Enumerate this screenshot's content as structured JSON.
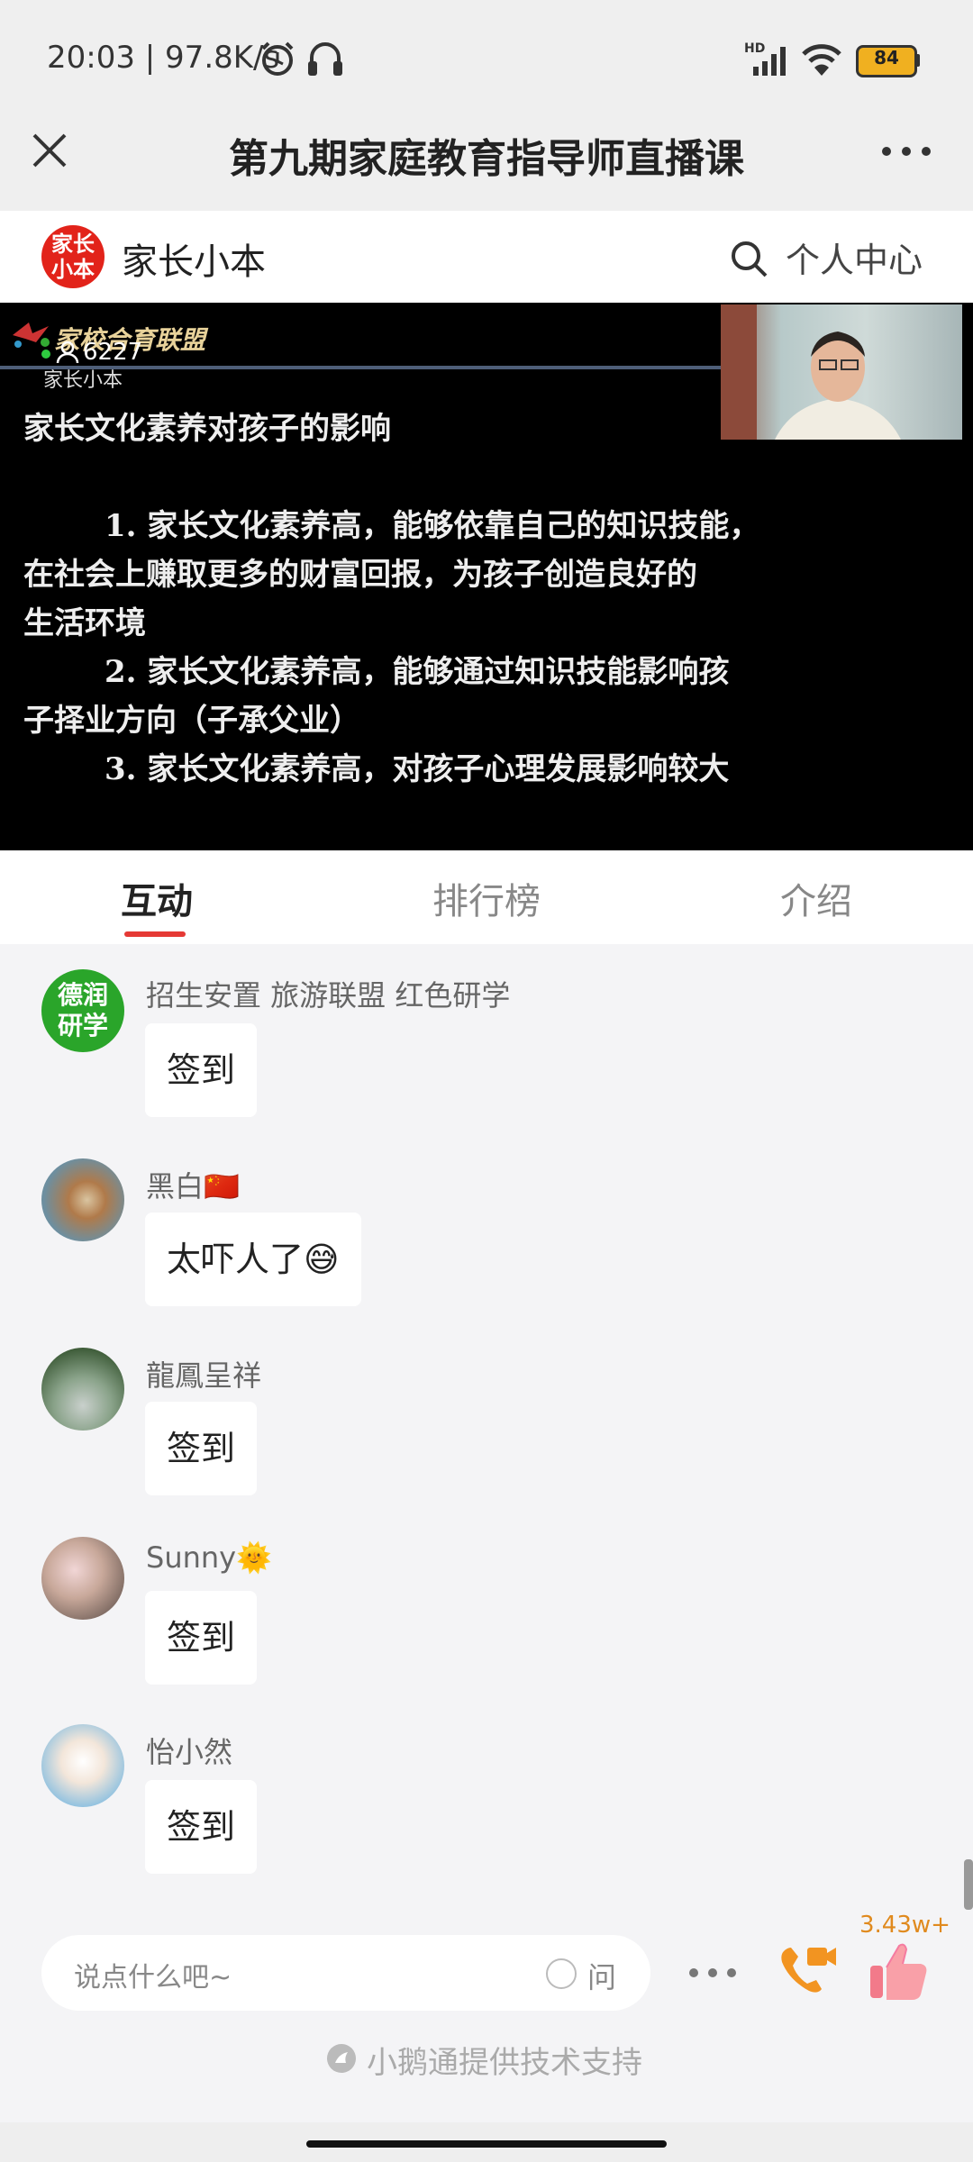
{
  "status_bar": {
    "time_speed": "20:03 | 97.8K/s",
    "battery": "84",
    "network": "HD"
  },
  "titlebar": {
    "title": "第九期家庭教育指导师直播课"
  },
  "header": {
    "logo_text": "家长小本",
    "brand": "家长小本",
    "personal_center": "个人中心"
  },
  "video": {
    "overlay_logo": "家校合育联盟",
    "watermark": "家长小本",
    "viewer_count": "6227",
    "slide_title": "家长文化素养对孩子的影响",
    "slide_lines": [
      "1. 家长文化素养高，能够依靠自己的知识技能，",
      "在社会上赚取更多的财富回报，为孩子创造良好的",
      "生活环境",
      "2. 家长文化素养高，能够通过知识技能影响孩",
      "子择业方向（子承父业）",
      "3. 家长文化素养高，对孩子心理发展影响较大"
    ]
  },
  "tabs": [
    {
      "label": "互动",
      "active": true
    },
    {
      "label": "排行榜",
      "active": false
    },
    {
      "label": "介绍",
      "active": false
    }
  ],
  "messages": [
    {
      "name": "招生安置 旅游联盟 红色研学",
      "text": "签到",
      "avatar_text": "德润研学",
      "avatar_color": "#2aa52a"
    },
    {
      "name": "黑白🇨🇳",
      "text": "太吓人了😅",
      "avatar_color": "#6d8fa0"
    },
    {
      "name": "龍鳳呈祥",
      "text": "签到",
      "avatar_color": "#5d7d5a"
    },
    {
      "name": "Sunny🌞",
      "text": "签到",
      "avatar_color": "#b89a8a"
    },
    {
      "name": "怡小然",
      "text": "签到",
      "avatar_color": "#8fc1e0"
    }
  ],
  "bottom_bar": {
    "input_placeholder": "说点什么吧~",
    "ask_label": "问",
    "likes": "3.43w+",
    "powered_by": "小鹅通提供技术支持"
  },
  "colors": {
    "accent": "#e53935",
    "brand_red": "#e2231a",
    "like_orange": "#e08a1e"
  }
}
